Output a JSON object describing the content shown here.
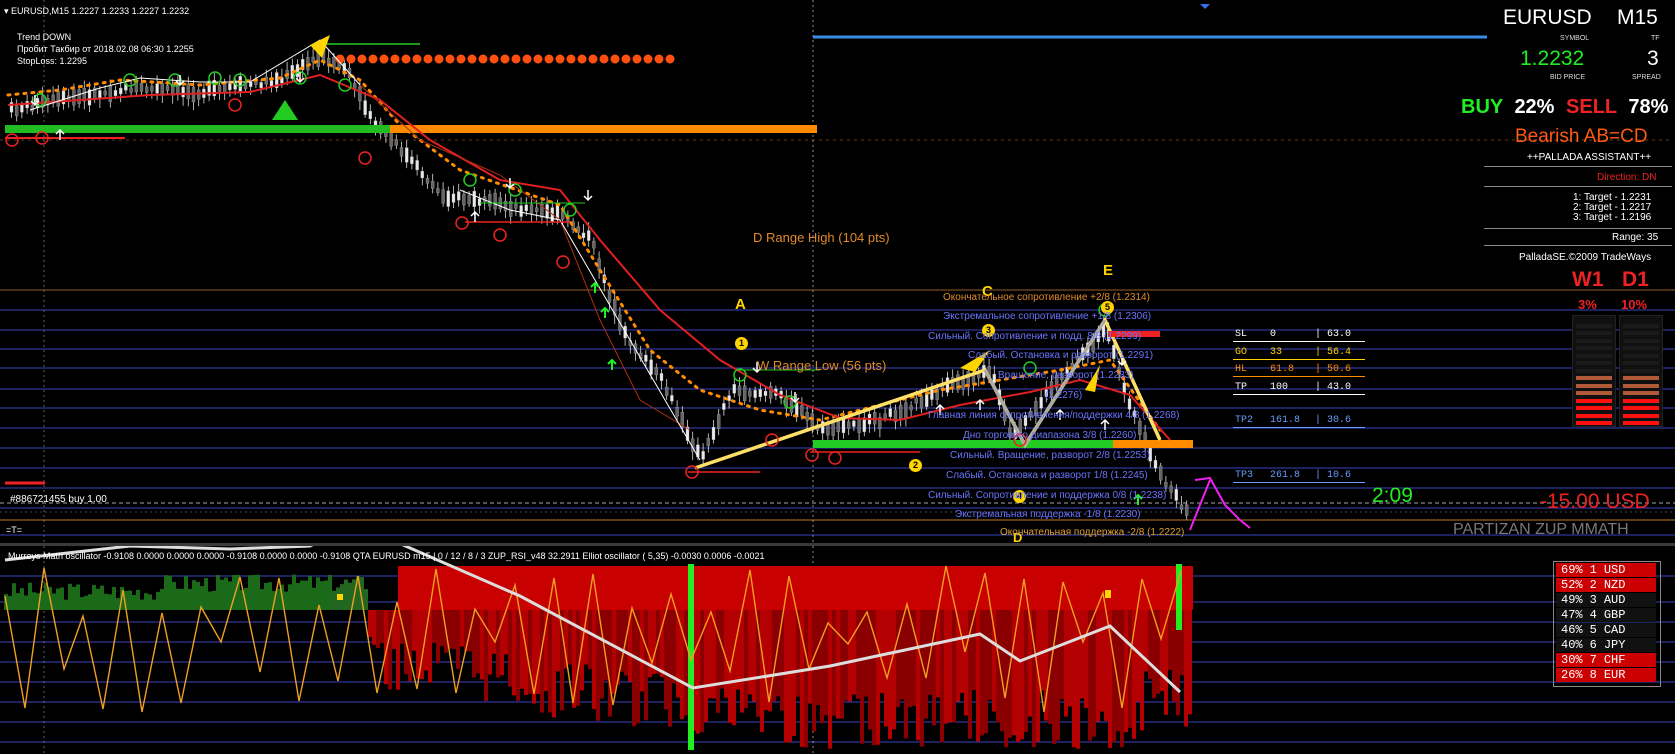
{
  "header": {
    "symbol_line": "EURUSD,M15  1.2227 1.2233 1.2227 1.2232",
    "trend": "Trend DOWN",
    "breakout": "Пробит Такбир от 2018.02.08 06:30 1.2255",
    "stoploss": "StopLoss: 1.2295"
  },
  "info_panel": {
    "symbol": "EURUSD",
    "symbol_caption": "SYMBOL",
    "tf": "M15",
    "tf_caption": "TF",
    "bid": "1.2232",
    "bid_caption": "BID PRICE",
    "spread": "3",
    "spread_caption": "SPREAD",
    "buy_label": "BUY",
    "buy_pct": "22%",
    "sell_label": "SELL",
    "sell_pct": "78%",
    "pattern": "Bearish AB=CD",
    "assistant": "++PALLADA ASSISTANT++",
    "direction": "Direction: DN",
    "targets": [
      "1: Target - 1.2231",
      "2: Target - 1.2217",
      "3: Target - 1.2196"
    ],
    "range": "Range: 35",
    "copyright": "PalladaSE.©2009 TradeWays",
    "w1_label": "W1",
    "d1_label": "D1",
    "w1_pct": "3%",
    "d1_pct": "10%",
    "timer": "2:09",
    "loss": "-15.00 USD",
    "partizan": "PARTIZAN ZUP MMATH"
  },
  "chart_labels": {
    "d_range": "D Range High (104 pts)",
    "w_range": "W Range Low (56 pts)",
    "order": "#886721455 buy 1.00",
    "point_a": "A",
    "point_c": "C",
    "point_e": "E",
    "point_d": "D",
    "n1": "1",
    "n2": "2",
    "n3": "3",
    "n4": "4",
    "n5": "5",
    "eq": "=T="
  },
  "murrey_levels": [
    "Окончательное сопротивление +2/8  (1.2314)",
    "Экстремальное сопротивление +1/8  (1.2306)",
    "Сильный. Сопротивление и подд. 8/8  (1.2299)",
    "Слабый. Остановка и разворот  (1.2291)",
    "Вращение, разворот  (1.2283)",
    "(1.2276)",
    "Главная линия сопротивления/поддержки 4/8  (1.2268)",
    "Дно торгового диапазона 3/8  (1.2260)",
    "Сильный. Вращение, разворот 2/8  (1.2253)",
    "Слабый. Остановка и разворот 1/8  (1.2245)",
    "Сильный. Сопротивление и поддержка 0/8  (1.2238)",
    "Экстремальная поддержка -1/8  (1.2230)",
    "Окончательная поддержка -2/8  (1.2222)"
  ],
  "fib_table": [
    {
      "name": "SL",
      "a": "0",
      "b": "63.0"
    },
    {
      "name": "GO",
      "a": "33",
      "b": "56.4"
    },
    {
      "name": "HL",
      "a": "61.8",
      "b": "50.6"
    },
    {
      "name": "TP",
      "a": "100",
      "b": "43.0"
    },
    {
      "name": "TP2",
      "a": "161.8",
      "b": "30.6"
    },
    {
      "name": "TP3",
      "a": "261.8",
      "b": "10.6"
    }
  ],
  "oscillator_header": "Murreys Math oscillator -0.9108 0.0000 0.0000 0.0000 -0.9108 0.0000 0.0000 -0.9108  QTA EURUSD m15 | 0 / 12 / 8 / 3  ZUP_RSI_v48 32.2911  Elliot oscillator ( 5,35) -0.0030 0.0006 -0.0021",
  "currency_strength": [
    {
      "pct": "69%",
      "rank": "1",
      "ccy": "USD",
      "bg": "#cc0000"
    },
    {
      "pct": "52%",
      "rank": "2",
      "ccy": "NZD",
      "bg": "#cc0000"
    },
    {
      "pct": "49%",
      "rank": "3",
      "ccy": "AUD",
      "bg": "#111111"
    },
    {
      "pct": "47%",
      "rank": "4",
      "ccy": "GBP",
      "bg": "#111111"
    },
    {
      "pct": "46%",
      "rank": "5",
      "ccy": "CAD",
      "bg": "#111111"
    },
    {
      "pct": "40%",
      "rank": "6",
      "ccy": "JPY",
      "bg": "#111111"
    },
    {
      "pct": "30%",
      "rank": "7",
      "ccy": "CHF",
      "bg": "#cc0000"
    },
    {
      "pct": "26%",
      "rank": "8",
      "ccy": "EUR",
      "bg": "#cc0000"
    }
  ],
  "colors": {
    "background": "#000000",
    "bull_green": "#22cc22",
    "bear_red": "#ee2222",
    "accent_orange": "#ff8c00",
    "level_blue": "#4a5aff",
    "hist_red": "#b40000"
  }
}
